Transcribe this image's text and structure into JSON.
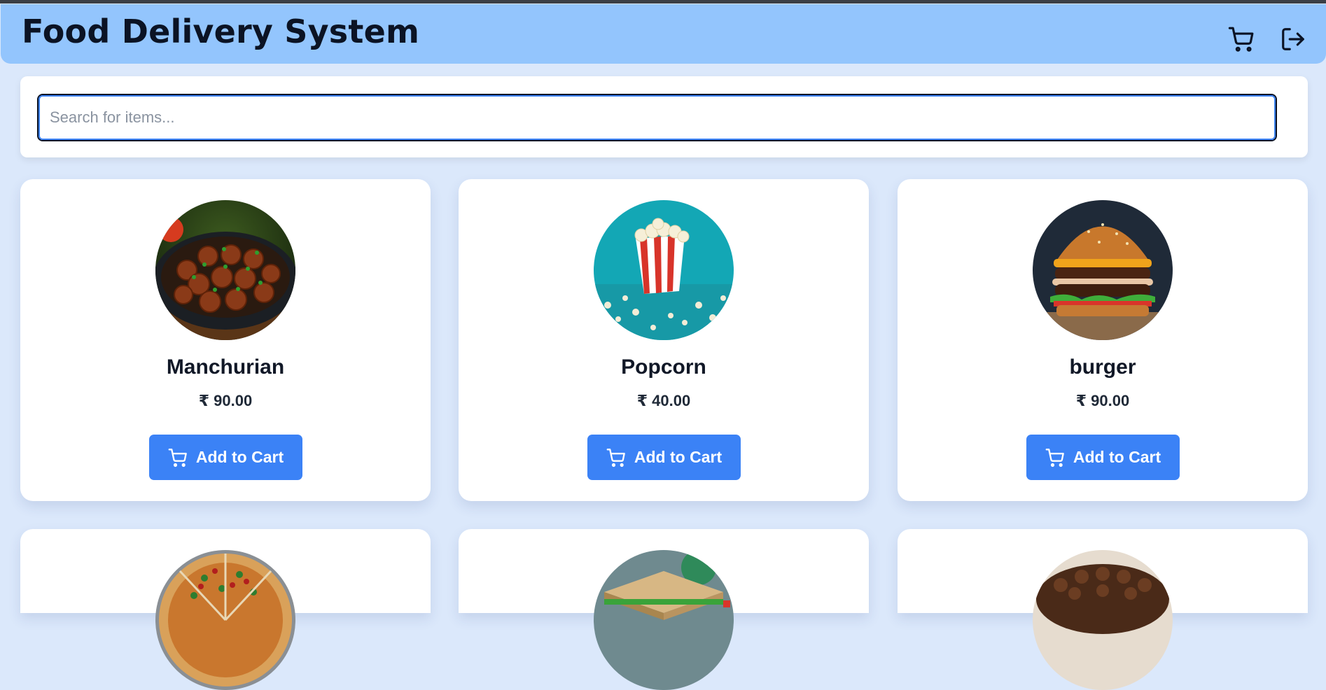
{
  "header": {
    "title": "Food Delivery System",
    "cart_icon": "shopping-cart-icon",
    "logout_icon": "logout-icon"
  },
  "search": {
    "placeholder": "Search for items...",
    "value": ""
  },
  "items": [
    {
      "name": "Manchurian",
      "price": "₹ 90.00",
      "button_label": "Add to Cart",
      "image": "meatballs-pan"
    },
    {
      "name": "Popcorn",
      "price": "₹ 40.00",
      "button_label": "Add to Cart",
      "image": "popcorn-box"
    },
    {
      "name": "burger",
      "price": "₹ 90.00",
      "button_label": "Add to Cart",
      "image": "cheeseburger"
    },
    {
      "image": "pizza"
    },
    {
      "image": "sandwich"
    },
    {
      "image": "chocolate-cake"
    }
  ],
  "colors": {
    "header_bg": "#93c5fd",
    "page_bg": "#dbe8fb",
    "button_bg": "#3b82f6"
  }
}
